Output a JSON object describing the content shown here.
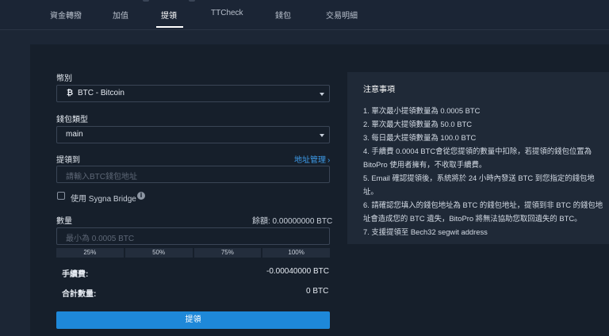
{
  "nav": {
    "tabs": [
      "資金轉撥",
      "加值",
      "提領",
      "TTCheck",
      "錢包",
      "交易明細"
    ],
    "active": "提領"
  },
  "form": {
    "currency_label": "幣別",
    "currency_icon": "₿",
    "currency_value": "BTC - Bitcoin",
    "wallet_type_label": "錢包類型",
    "wallet_type_value": "main",
    "withdraw_to_label": "提領到",
    "address_manage_link": "地址管理",
    "address_placeholder": "請輸入BTC錢包地址",
    "sygna_label": "使用 Sygna Bridge",
    "amount_label": "數量",
    "balance_text": "餘額: 0.00000000 BTC",
    "amount_placeholder": "最小為 0.0005 BTC",
    "percent_buttons": [
      "25%",
      "50%",
      "75%",
      "100%"
    ],
    "fee_label": "手續費:",
    "fee_value": "-0.00040000 BTC",
    "total_label": "合計數量:",
    "total_value": "0 BTC",
    "submit_label": "提領"
  },
  "notice": {
    "title": "注意事項",
    "items": [
      "1. 單次最小提領數量為 0.0005 BTC",
      "2. 單次最大提領數量為 50.0 BTC",
      "3. 每日最大提領數量為 100.0 BTC",
      "4. 手續費 0.0004 BTC會從您提領的數量中扣除，若提領的錢包位置為 BitoPro 使用者擁有，不收取手續費。",
      "5. Email 確認提領後，系統將於 24 小時內發送 BTC 到您指定的錢包地址。",
      "6. 請確認您填入的錢包地址為 BTC 的錢包地址，提領到非 BTC 的錢包地址會造成您的 BTC 遺失，BitoPro 將無法協助您取回遺失的 BTC。",
      "7. 支援提領至 Bech32 segwit address"
    ]
  },
  "colors": {
    "accent": "#1e88d9",
    "link": "#3d9be9",
    "background": "#1c2635",
    "panel": "#161f2b"
  }
}
